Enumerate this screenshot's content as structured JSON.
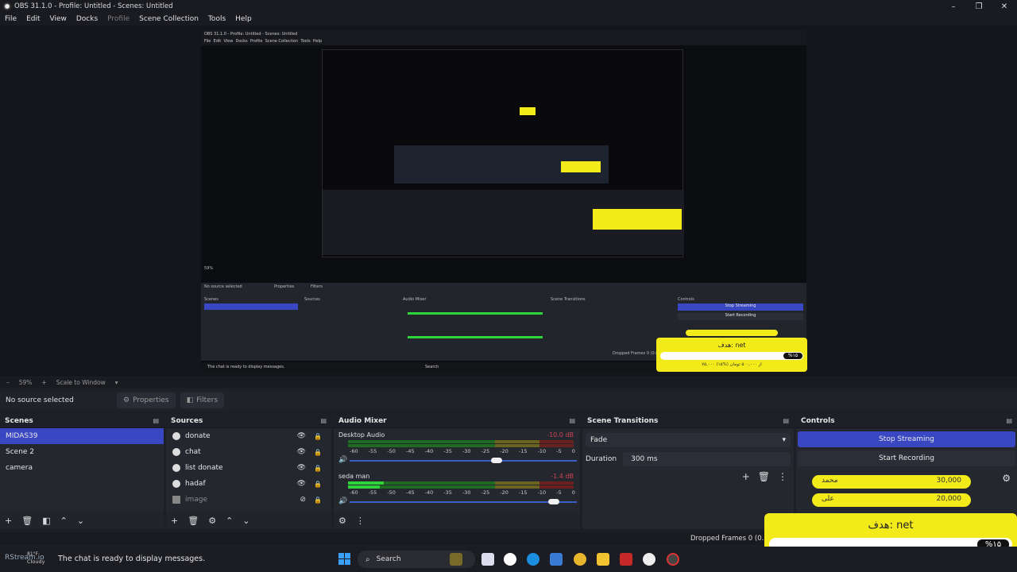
{
  "window": {
    "title": "OBS 31.1.0 - Profile: Untitled - Scenes: Untitled"
  },
  "menu": [
    "File",
    "Edit",
    "View",
    "Docks",
    "Profile",
    "Scene Collection",
    "Tools",
    "Help"
  ],
  "preview_caption": {
    "no_source": "No source selected",
    "properties": "Properties",
    "filters": "Filters",
    "scenes": "Scenes",
    "sources": "Sources",
    "mixer": "Audio Mixer",
    "transitions": "Scene Transitions",
    "controls": "Controls",
    "stop": "Stop Streaming",
    "start_rec": "Start Recording",
    "chat": "The chat is ready to display messages.",
    "search": "Search",
    "dropped": "Dropped Frames 0 (0.0%)"
  },
  "zoom": {
    "level": "59%",
    "mode": "Scale to Window"
  },
  "source_toolbar": {
    "status": "No source selected",
    "properties": "Properties",
    "filters": "Filters"
  },
  "scenes": {
    "title": "Scenes",
    "items": [
      "MIDAS39",
      "Scene 2",
      "camera"
    ]
  },
  "sources": {
    "title": "Sources",
    "items": [
      "donate",
      "chat",
      "list donate",
      "hadaf",
      "image"
    ]
  },
  "mixer": {
    "title": "Audio Mixer",
    "tracks": [
      {
        "name": "Desktop Audio",
        "db": "-10.0 dB"
      },
      {
        "name": "seda man",
        "db": "-1.4 dB"
      }
    ],
    "scale": [
      "-60",
      "-55",
      "-50",
      "-45",
      "-40",
      "-35",
      "-30",
      "-25",
      "-20",
      "-15",
      "-10",
      "-5",
      "0"
    ]
  },
  "transitions": {
    "title": "Scene Transitions",
    "selected": "Fade",
    "duration_label": "Duration",
    "duration_value": "300 ms"
  },
  "controls": {
    "title": "Controls",
    "stop_streaming": "Stop Streaming",
    "start_recording": "Start Recording"
  },
  "donations": [
    {
      "name": "محمد",
      "amount": "30,000"
    },
    {
      "name": "علی",
      "amount": "20,000"
    }
  ],
  "goal": {
    "title": "هدف: net",
    "percent": "%۱۵",
    "summary": "۷۵,۰۰۰ از ۵۰۰,۰۰۰ تومان (%۱۵)",
    "progress": 0.15
  },
  "status": {
    "dropped": "Dropped Frames 0 (0.0%)"
  },
  "taskbar": {
    "chat": "The chat is ready to display messages.",
    "weather_temp": "81°F",
    "weather": "Cloudy",
    "logo": "RStream.io",
    "search": "Search"
  },
  "colors": {
    "accent": "#3a47c2",
    "yellow": "#f3ea1a",
    "bg": "#1d1f26"
  }
}
